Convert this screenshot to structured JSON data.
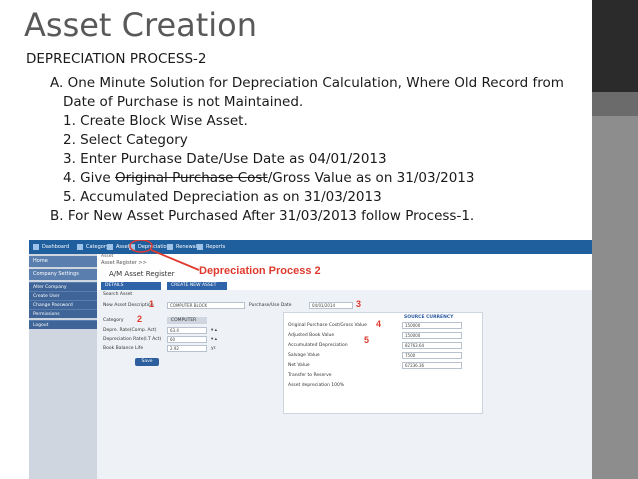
{
  "slide": {
    "title": "Asset Creation",
    "subtitle": "DEPRECIATION PROCESS-2",
    "line_a_1": "A. One Minute Solution for Depreciation Calculation, Where Old Record from",
    "line_a_2": "Date of Purchase is not Maintained.",
    "step1": "1. Create Block Wise Asset.",
    "step2": "2. Select Category",
    "step3": "3. Enter Purchase Date/Use Date as 04/01/2013",
    "step4_prefix": "4. Give ",
    "step4_struck": "Original Purchase Cost",
    "step4_suffix": "/Gross Value as on 31/03/2013",
    "step5": "5. Accumulated Depreciation as on 31/03/2013",
    "line_b": "B. For New Asset Purchased After 31/03/2013 follow Process-1."
  },
  "colors": {
    "accent_dark": "#2b2b2b",
    "accent_gray": "#8d8d8d",
    "nav_blue": "#1f5f9e",
    "annotation_red": "#e03a2e"
  },
  "app": {
    "topnav": {
      "dashboard": "Dashboard",
      "category": "Category",
      "asset": "Asset",
      "depreciation": "Depreciation",
      "renewal": "Renewal",
      "reports": "Reports"
    },
    "sidebar": {
      "home": "Home",
      "company_settings": "Company Settings",
      "items": [
        "Alter Company",
        "Create User",
        "Change Password",
        "Permissions",
        "Logout"
      ]
    },
    "asset_dropdown": "Asset",
    "breadcrumb": "Asset Register >>",
    "page_title": "A/M Asset Register",
    "annotation_title": "Depreciation Process 2",
    "tabs": {
      "details": "DETAILS",
      "create_new": "CREATE NEW ASSET"
    },
    "form": {
      "search_asset": "Search Asset",
      "new_asset_description": "New Asset Description",
      "new_asset_value": "COMPUTER BLOCK",
      "purchase_use_date_label": "Purchase/Use Date",
      "purchase_use_date_value": "04/01/2014",
      "category_label": "Category",
      "category_value": "COMPUTER",
      "rate_comp_label": "Depre. Rate(Comp. Act)",
      "rate_comp_value": "63.4",
      "rate_it_label": "Depreciation Rate(I.T Act)",
      "rate_it_value": "60",
      "book_balance_label": "Book Balance Life",
      "book_balance_value": "2.92",
      "book_balance_unit": "yr.",
      "save": "Save"
    },
    "source": {
      "header": "SOURCE CURRENCY",
      "original_purchase_label": "Original Purchase Cost/Gross Value",
      "original_purchase_value": "150000",
      "adjusted_book_label": "Adjusted Book Value",
      "adjusted_book_value": "150000",
      "accumulated_label": "Accumulated Depreciation",
      "accumulated_value": "82763.64",
      "salvage_label": "Salvage Value",
      "salvage_value": "7500",
      "net_value_label": "Net Value",
      "net_value_value": "67236.36",
      "transfer_label": "Transfer to Reserve",
      "asset_dep_label": "Asset depreciation 100%"
    },
    "annotations": [
      "1",
      "2",
      "3",
      "4",
      "5"
    ]
  }
}
